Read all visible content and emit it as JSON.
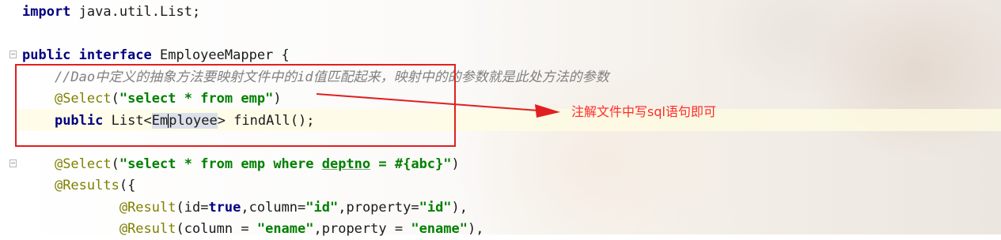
{
  "editor": {
    "lines": [
      {
        "parts": [
          {
            "cls": "kw",
            "text": "import"
          },
          {
            "cls": "",
            "text": " java.util.List;"
          }
        ]
      },
      {
        "parts": []
      },
      {
        "parts": [
          {
            "cls": "kw",
            "text": "public interface"
          },
          {
            "cls": "",
            "text": " EmployeeMapper {"
          }
        ]
      },
      {
        "parts": [
          {
            "cls": "cmt",
            "text": "    //Dao中定义的抽象方法要映射文件中的id值匹配起来，映射中的的参数就是此处方法的参数"
          }
        ]
      },
      {
        "parts": [
          {
            "cls": "",
            "text": "    "
          },
          {
            "cls": "ann",
            "text": "@Select"
          },
          {
            "cls": "",
            "text": "("
          },
          {
            "cls": "str",
            "text": "\"select * from emp\""
          },
          {
            "cls": "",
            "text": ")"
          }
        ]
      },
      {
        "parts": [
          {
            "cls": "",
            "text": "    "
          },
          {
            "cls": "kw",
            "text": "public"
          },
          {
            "cls": "",
            "text": " List<"
          },
          {
            "cls": "usage",
            "text": "Em"
          },
          {
            "cls": "caret",
            "text": ""
          },
          {
            "cls": "usage",
            "text": "ployee"
          },
          {
            "cls": "",
            "text": "> findAll();"
          }
        ]
      },
      {
        "parts": []
      },
      {
        "parts": [
          {
            "cls": "",
            "text": "    "
          },
          {
            "cls": "ann",
            "text": "@Select"
          },
          {
            "cls": "",
            "text": "("
          },
          {
            "cls": "str",
            "text": "\"select * from emp where "
          },
          {
            "cls": "str und",
            "text": "deptno"
          },
          {
            "cls": "str",
            "text": " = #{abc}\""
          },
          {
            "cls": "",
            "text": ")"
          }
        ]
      },
      {
        "parts": [
          {
            "cls": "",
            "text": "    "
          },
          {
            "cls": "ann",
            "text": "@Results"
          },
          {
            "cls": "",
            "text": "({"
          }
        ]
      },
      {
        "parts": [
          {
            "cls": "",
            "text": "            "
          },
          {
            "cls": "ann",
            "text": "@Result"
          },
          {
            "cls": "",
            "text": "(id="
          },
          {
            "cls": "kw",
            "text": "true"
          },
          {
            "cls": "",
            "text": ",column="
          },
          {
            "cls": "str",
            "text": "\"id\""
          },
          {
            "cls": "",
            "text": ",property="
          },
          {
            "cls": "str",
            "text": "\"id\""
          },
          {
            "cls": "",
            "text": "),"
          }
        ]
      },
      {
        "parts": [
          {
            "cls": "",
            "text": "            "
          },
          {
            "cls": "ann",
            "text": "@Result"
          },
          {
            "cls": "",
            "text": "(column = "
          },
          {
            "cls": "str",
            "text": "\"ename\""
          },
          {
            "cls": "",
            "text": ",property = "
          },
          {
            "cls": "str",
            "text": "\"ename\""
          },
          {
            "cls": "",
            "text": "),"
          }
        ]
      }
    ]
  },
  "annotation": {
    "note": "注解文件中写sql语句即可",
    "color": "#ff2a2a"
  }
}
